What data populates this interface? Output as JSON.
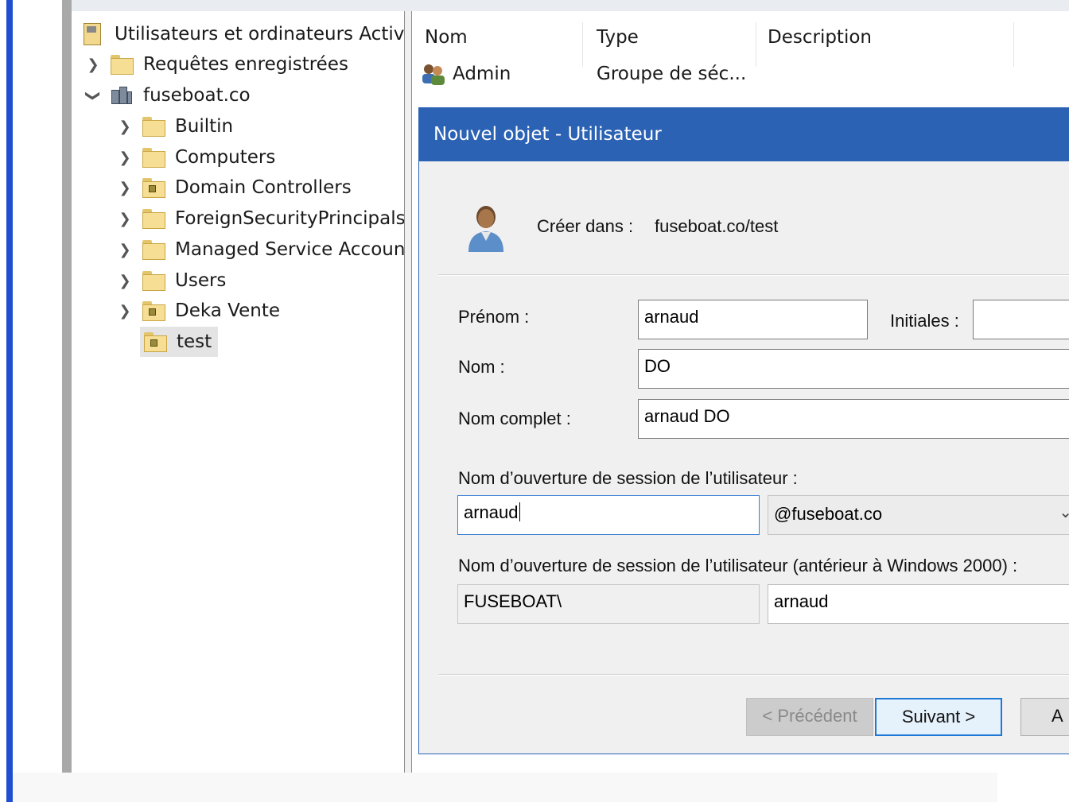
{
  "tree": {
    "root_label": "Utilisateurs et ordinateurs Active",
    "items": [
      {
        "label": "Requêtes enregistrées"
      },
      {
        "label": "fuseboat.co"
      },
      {
        "label": "Builtin"
      },
      {
        "label": "Computers"
      },
      {
        "label": "Domain Controllers"
      },
      {
        "label": "ForeignSecurityPrincipals"
      },
      {
        "label": "Managed Service Accoun"
      },
      {
        "label": "Users"
      },
      {
        "label": "Deka Vente"
      },
      {
        "label": "test"
      }
    ]
  },
  "list": {
    "columns": [
      "Nom",
      "Type",
      "Description"
    ],
    "rows": [
      {
        "name": "Admin",
        "type": "Groupe de séc..."
      }
    ]
  },
  "dialog": {
    "title": "Nouvel objet - Utilisateur",
    "create_in_label": "Créer dans :",
    "create_in_value": "fuseboat.co/test",
    "first_name_label": "Prénom :",
    "first_name_value": "arnaud",
    "initials_label": "Initiales :",
    "initials_value": "",
    "last_name_label": "Nom :",
    "last_name_value": "DO",
    "full_name_label": "Nom complet :",
    "full_name_value": "arnaud DO",
    "logon_label": "Nom d’ouverture de session de l’utilisateur :",
    "logon_value": "arnaud",
    "domain_suffix": "@fuseboat.co",
    "legacy_logon_label": "Nom d’ouverture de session de l’utilisateur (antérieur à Windows 2000) :",
    "legacy_domain": "FUSEBOAT\\",
    "legacy_logon_value": "arnaud",
    "buttons": {
      "previous": "< Précédent",
      "next": "Suivant >",
      "cancel": "A"
    }
  }
}
